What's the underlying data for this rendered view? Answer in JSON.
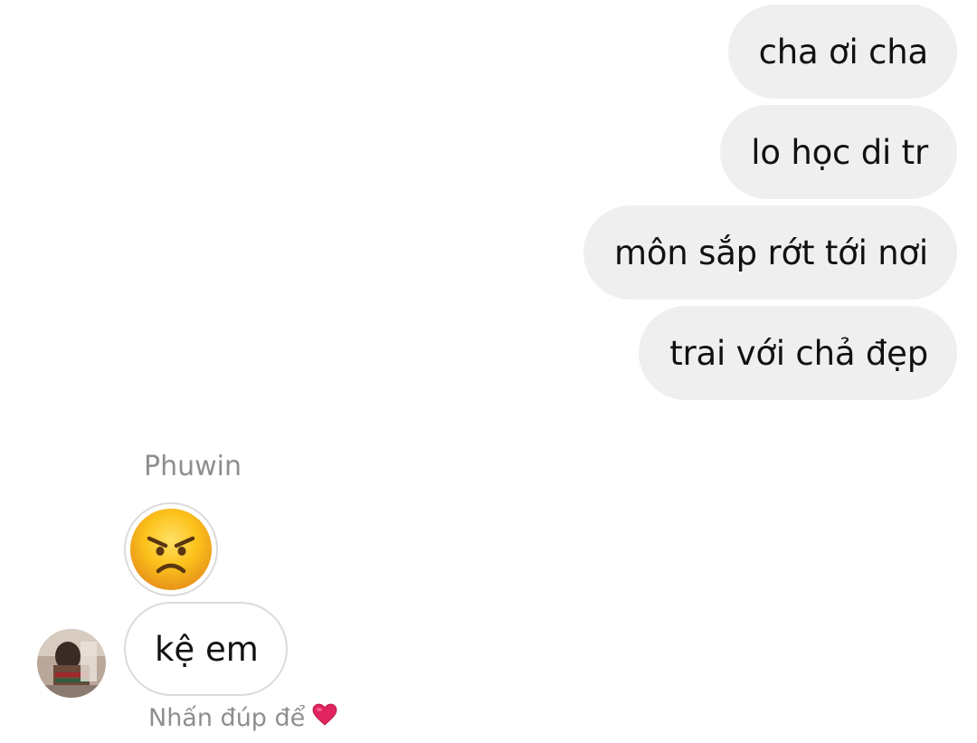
{
  "outgoing_messages": [
    {
      "text": "cha ơi cha"
    },
    {
      "text": "lo học di tr"
    },
    {
      "text": "môn sắp rớt tới nơi"
    },
    {
      "text": "trai với chả đẹp"
    }
  ],
  "incoming": {
    "sender_name": "Phuwin",
    "emoji_message": "angry-face-emoji",
    "text_message": "kệ em",
    "hint": "Nhấn đúp để",
    "hint_icon": "red-heart-icon"
  },
  "colors": {
    "outgoing_bubble": "#efefef",
    "incoming_border": "#dbdbdb",
    "meta_text": "#8e8e8e",
    "heart": "#e0245e"
  }
}
